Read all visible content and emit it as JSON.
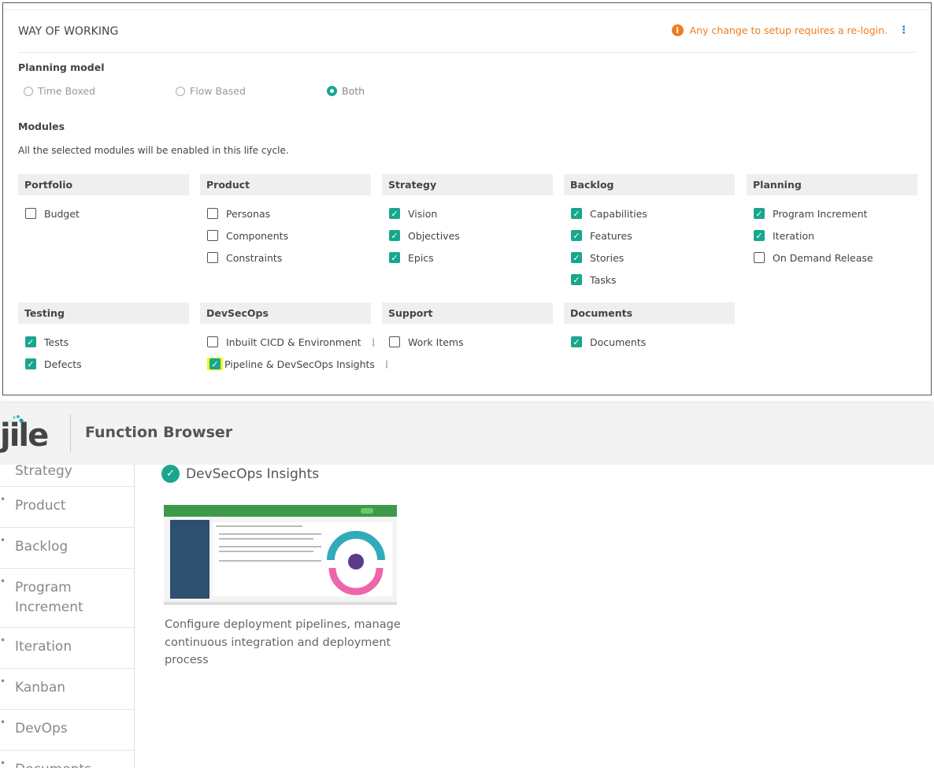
{
  "way_of_working": {
    "title": "WAY OF WORKING",
    "notice": "Any change to setup requires a re-login.",
    "planning_model_label": "Planning model",
    "planning_options": [
      {
        "label": "Time Boxed",
        "selected": false
      },
      {
        "label": "Flow Based",
        "selected": false
      },
      {
        "label": "Both",
        "selected": true
      }
    ],
    "modules_label": "Modules",
    "modules_desc": "All the selected modules will be enabled in this life cycle.",
    "accent": "#1aa68e",
    "notice_color": "#f07c1b",
    "groups": [
      {
        "name": "Portfolio",
        "items": [
          {
            "label": "Budget",
            "checked": false
          }
        ]
      },
      {
        "name": "Product",
        "items": [
          {
            "label": "Personas",
            "checked": false
          },
          {
            "label": "Components",
            "checked": false
          },
          {
            "label": "Constraints",
            "checked": false
          }
        ]
      },
      {
        "name": "Strategy",
        "items": [
          {
            "label": "Vision",
            "checked": true
          },
          {
            "label": "Objectives",
            "checked": true
          },
          {
            "label": "Epics",
            "checked": true
          }
        ]
      },
      {
        "name": "Backlog",
        "items": [
          {
            "label": "Capabilities",
            "checked": true
          },
          {
            "label": "Features",
            "checked": true
          },
          {
            "label": "Stories",
            "checked": true
          },
          {
            "label": "Tasks",
            "checked": true
          }
        ]
      },
      {
        "name": "Planning",
        "items": [
          {
            "label": "Program Increment",
            "checked": true
          },
          {
            "label": "Iteration",
            "checked": true
          },
          {
            "label": "On Demand Release",
            "checked": false
          }
        ]
      },
      {
        "name": "Testing",
        "items": [
          {
            "label": "Tests",
            "checked": true
          },
          {
            "label": "Defects",
            "checked": true
          }
        ]
      },
      {
        "name": "DevSecOps",
        "items": [
          {
            "label": "Inbuilt CICD & Environment",
            "checked": false,
            "info": true
          },
          {
            "label": "Pipeline & DevSecOps Insights",
            "checked": true,
            "info": true,
            "highlighted": true
          }
        ]
      },
      {
        "name": "Support",
        "items": [
          {
            "label": "Work Items",
            "checked": false
          }
        ]
      },
      {
        "name": "Documents",
        "items": [
          {
            "label": "Documents",
            "checked": true
          }
        ]
      }
    ]
  },
  "browser": {
    "logo": "jile",
    "title": "Function Browser",
    "sidebar": [
      "Strategy",
      "Product",
      "Backlog",
      "Program Increment",
      "Iteration",
      "Kanban",
      "DevOps",
      "Documents"
    ],
    "content_title": "DevSecOps Insights",
    "content_desc": "Configure deployment pipelines, manage continuous integration and deployment process"
  }
}
